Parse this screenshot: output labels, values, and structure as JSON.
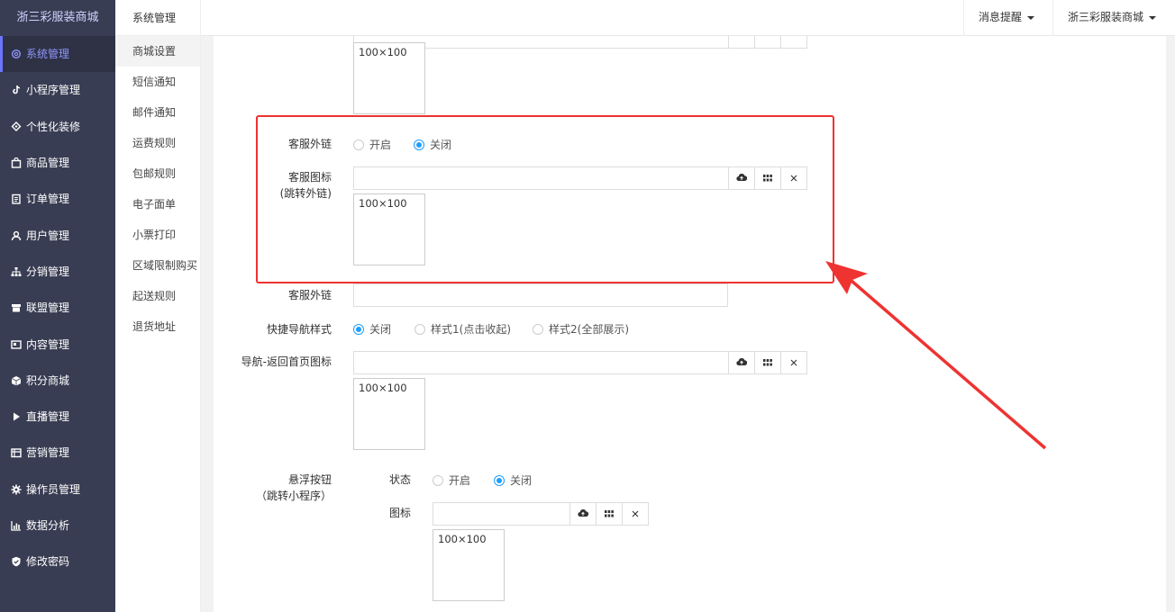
{
  "sidebar": {
    "brand": "浙三彩服装商城",
    "items": [
      {
        "label": "系统管理",
        "icon": "gear-outline-icon",
        "active": true
      },
      {
        "label": "小程序管理",
        "icon": "tiktok-icon"
      },
      {
        "label": "个性化装修",
        "icon": "decor-icon"
      },
      {
        "label": "商品管理",
        "icon": "bag-icon"
      },
      {
        "label": "订单管理",
        "icon": "order-icon"
      },
      {
        "label": "用户管理",
        "icon": "user-icon"
      },
      {
        "label": "分销管理",
        "icon": "sitemap-icon"
      },
      {
        "label": "联盟管理",
        "icon": "store-icon"
      },
      {
        "label": "内容管理",
        "icon": "content-icon"
      },
      {
        "label": "积分商城",
        "icon": "cube-icon"
      },
      {
        "label": "直播管理",
        "icon": "play-icon"
      },
      {
        "label": "营销管理",
        "icon": "marketing-icon"
      },
      {
        "label": "操作员管理",
        "icon": "gear-icon"
      },
      {
        "label": "数据分析",
        "icon": "bar-chart-icon"
      },
      {
        "label": "修改密码",
        "icon": "shield-check-icon"
      }
    ]
  },
  "submenu": {
    "title": "系统管理",
    "items": [
      "商城设置",
      "短信通知",
      "邮件通知",
      "运费规则",
      "包邮规则",
      "电子面单",
      "小票打印",
      "区域限制购买",
      "起送规则",
      "退货地址"
    ]
  },
  "topbar": {
    "messages": "消息提醒",
    "shop": "浙三彩服装商城"
  },
  "form": {
    "thumb_text": "100×100",
    "kefu_link_label": "客服外链",
    "kefu_link_on": "开启",
    "kefu_link_off": "关闭",
    "kefu_icon_label": "客服图标",
    "kefu_icon_sub": "(跳转外链)",
    "kefu_url_label": "客服外链",
    "nav_style_label": "快捷导航样式",
    "nav_style_off": "关闭",
    "nav_style_1": "样式1(点击收起)",
    "nav_style_2": "样式2(全部展示)",
    "nav_home_icon_label": "导航-返回首页图标",
    "float_btn_label": "悬浮按钮",
    "float_btn_sub": "（跳转小程序）",
    "float_status_label": "状态",
    "float_on": "开启",
    "float_off": "关闭",
    "float_icon_label": "图标"
  },
  "colors": {
    "sidebar_bg": "#393d53",
    "accent": "#1e9fff",
    "highlight": "#ee3331"
  }
}
